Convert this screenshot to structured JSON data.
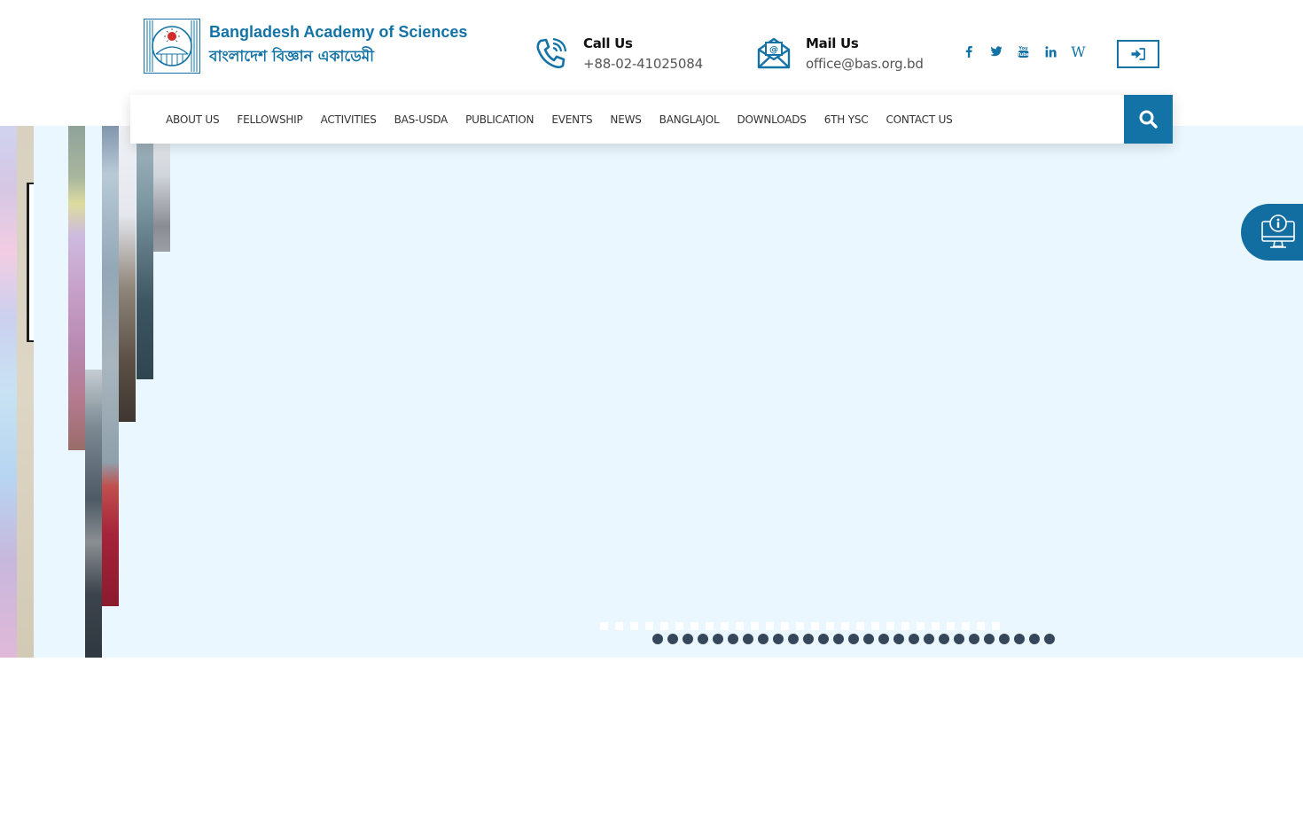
{
  "header": {
    "logo_en": "Bangladesh Academy of Sciences",
    "logo_bn": "বাংলাদেশ বিজ্ঞান একাডেমী",
    "call": {
      "title": "Call Us",
      "value": "+88-02-41025084",
      "icon": "phone-icon"
    },
    "mail": {
      "title": "Mail Us",
      "value": "office@bas.org.bd",
      "icon": "envelope-icon"
    },
    "social": [
      "facebook-icon",
      "twitter-icon",
      "youtube-icon",
      "linkedin-icon",
      "wikipedia-icon"
    ],
    "wikipedia_glyph": "W",
    "login_icon": "sign-in-icon"
  },
  "nav": {
    "items": [
      "ABOUT US",
      "FELLOWSHIP",
      "ACTIVITIES",
      "BAS-USDA",
      "PUBLICATION",
      "EVENTS",
      "NEWS",
      "BANGLAJOL",
      "DOWNLOADS",
      "6TH YSC",
      "CONTACT US"
    ],
    "search_icon": "search-icon"
  },
  "slider": {
    "slide_count": 27,
    "thumb_count": 27
  },
  "side_widget": {
    "icon": "info-monitor-icon"
  },
  "colors": {
    "brand": "#1473a6",
    "hero_bg": "#eaf7fe",
    "pager_dot": "#37475b"
  }
}
